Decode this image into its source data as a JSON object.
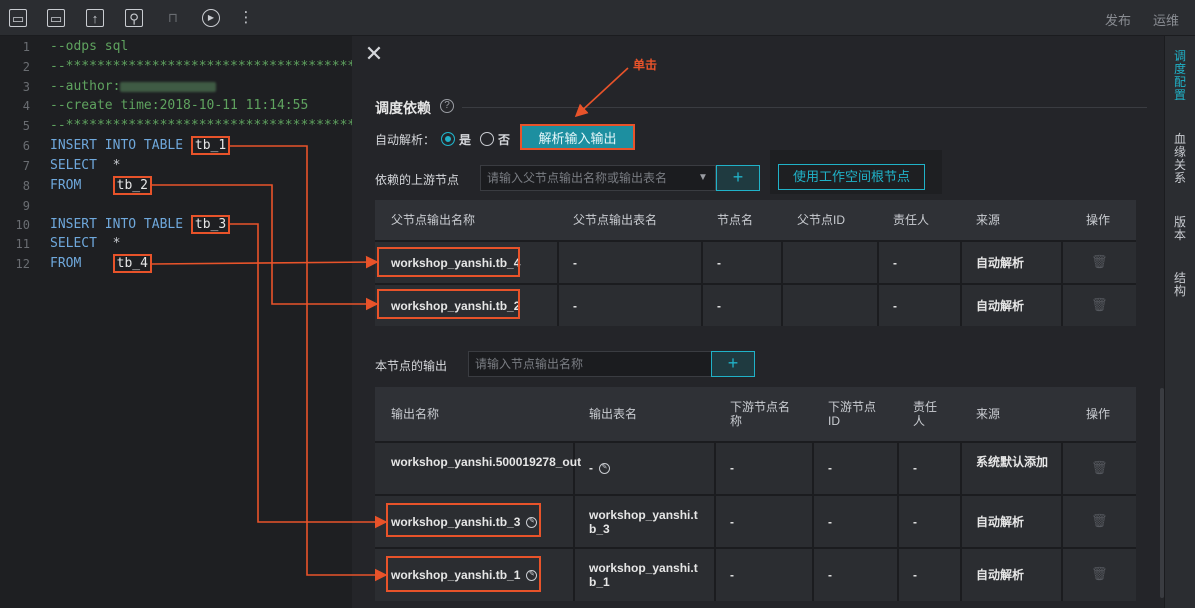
{
  "toolbar": {
    "icons": [
      "save-icon",
      "save-as-icon",
      "submit-icon",
      "steal-lock-icon",
      "lock-icon",
      "run-icon",
      "more-icon"
    ],
    "publish_label": "发布",
    "ops_label": "运维"
  },
  "editor": {
    "line_numbers": [
      "1",
      "2",
      "3",
      "4",
      "5",
      "6",
      "7",
      "8",
      "9",
      "10",
      "11",
      "12"
    ],
    "lines": {
      "l1": "--odps sql",
      "l2": "--*********************************************",
      "l3_prefix": "--author:",
      "l4": "--create time:2018-10-11 11:14:55",
      "l5": "--*********************************************",
      "insert_kw": "INSERT INTO TABLE",
      "select_kw": "SELECT",
      "star": "*",
      "from_kw": "FROM",
      "tb1": "tb_1",
      "tb2": "tb_2",
      "tb3": "tb_3",
      "tb4": "tb_4"
    }
  },
  "panel": {
    "section_title": "调度依赖",
    "auto_parse_label": "自动解析：",
    "yes_label": "是",
    "no_label": "否",
    "parse_button": "解析输入输出",
    "annotation": "单击",
    "upstream_label": "依赖的上游节点",
    "upstream_placeholder": "请输入父节点输出名称或输出表名",
    "add_symbol": "+",
    "workspace_root_button": "使用工作空间根节点",
    "output_label": "本节点的输出",
    "output_placeholder": "请输入节点输出名称"
  },
  "upstream_table": {
    "headers": [
      "父节点输出名称",
      "父节点输出表名",
      "节点名",
      "父节点ID",
      "责任人",
      "来源",
      "操作"
    ],
    "rows": [
      {
        "output_name": "workshop_yanshi.tb_4",
        "table_name": "-",
        "node_name": "-",
        "owner": "-",
        "source": "自动解析"
      },
      {
        "output_name": "workshop_yanshi.tb_2",
        "table_name": "-",
        "node_name": "-",
        "owner": "-",
        "source": "自动解析"
      }
    ]
  },
  "output_table": {
    "headers": [
      "输出名称",
      "输出表名",
      "下游节点名称",
      "下游节点ID",
      "责任人",
      "来源",
      "操作"
    ],
    "rows": [
      {
        "output_name": "workshop_yanshi.500019278_out",
        "table_name": "-",
        "node_name": "-",
        "node_id": "-",
        "owner": "-",
        "source": "系统默认添加"
      },
      {
        "output_name": "workshop_yanshi.tb_3",
        "table_name": "workshop_yanshi.tb_3",
        "node_name": "-",
        "node_id": "-",
        "owner": "-",
        "source": "自动解析"
      },
      {
        "output_name": "workshop_yanshi.tb_1",
        "table_name": "workshop_yanshi.tb_1",
        "node_name": "-",
        "node_id": "-",
        "owner": "-",
        "source": "自动解析"
      }
    ]
  },
  "right_tabs": [
    "调度配置",
    "血缘关系",
    "版本",
    "结构"
  ],
  "colors": {
    "accent": "#20b2c8",
    "highlight": "#e8532a"
  }
}
